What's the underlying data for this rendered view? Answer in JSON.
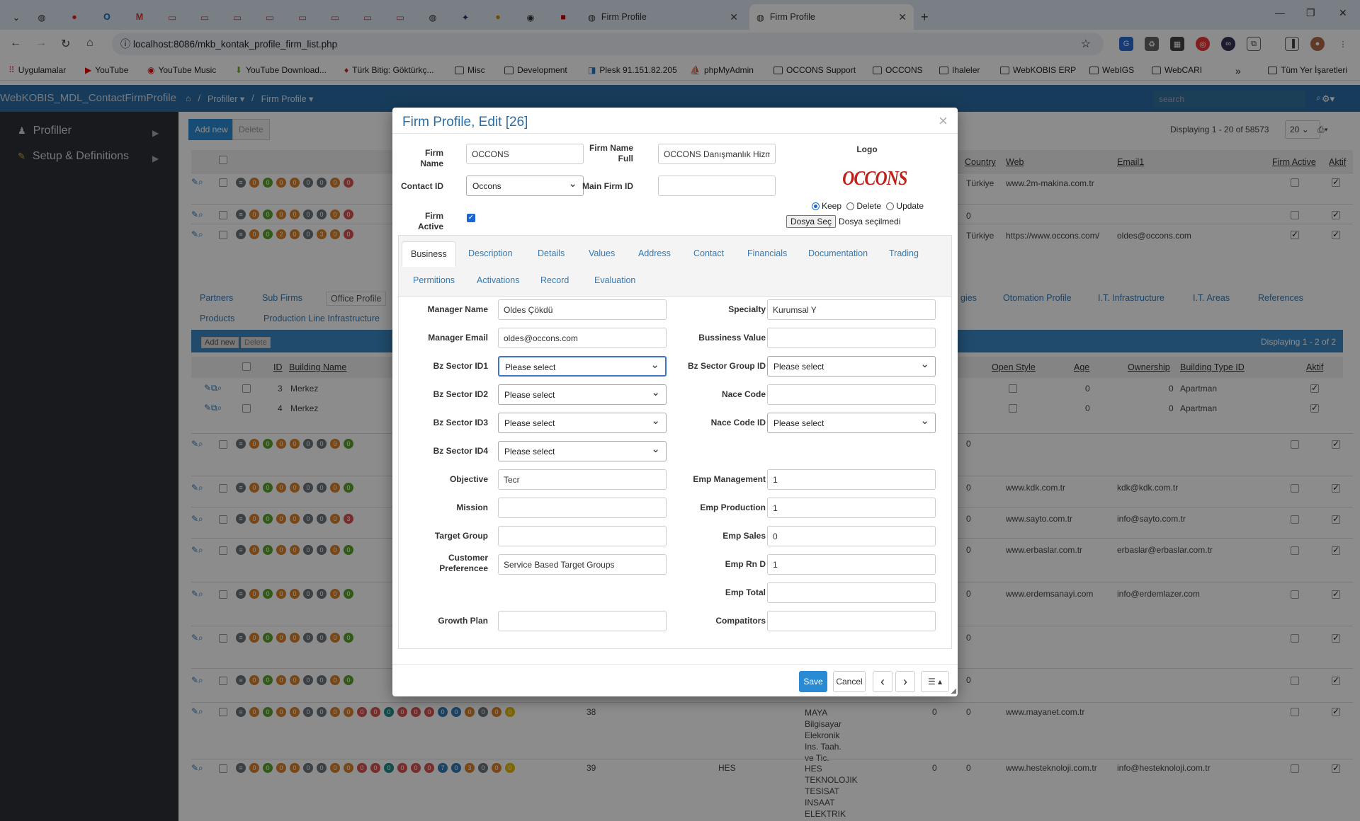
{
  "browser": {
    "tabs": [
      {
        "label": "Firm Profile",
        "active": false
      },
      {
        "label": "Firm Profile",
        "active": true
      }
    ],
    "url": "localhost:8086/mkb_kontak_profile_firm_list.php",
    "new_tab": "+",
    "bookmarks": [
      "Uygulamalar",
      "YouTube",
      "YouTube Music",
      "YouTube Download...",
      "Türk Bitig: Göktürkç...",
      "Misc",
      "Development",
      "Plesk 91.151.82.205",
      "phpMyAdmin",
      "OCCONS Support",
      "OCCONS",
      "Ihaleler",
      "WebKOBIS ERP",
      "WebIGS",
      "WebCARI",
      "Tüm Yer İşaretleri"
    ]
  },
  "app": {
    "title": "WebKOBIS_MDL_ContactFirmProfile",
    "breadcrumb": [
      "Profiller ▾",
      "/",
      "Firm Profile ▾"
    ],
    "search_placeholder": "search",
    "sidebar": [
      {
        "label": "Profiller",
        "icon": "user-icon"
      },
      {
        "label": "Setup & Definitions",
        "icon": "wrench-icon"
      }
    ]
  },
  "background": {
    "add_new": "Add new",
    "delete": "Delete",
    "displaying": "Displaying 1 - 20 of 58573",
    "page_size": "20",
    "columns": [
      "Country",
      "Web",
      "Email1",
      "Firm Active",
      "Aktif"
    ],
    "rows": [
      {
        "country": "Türkiye",
        "web": "www.2m-makina.com.tr",
        "email": ""
      },
      {
        "country": "0",
        "web": "",
        "email": ""
      },
      {
        "country": "Türkiye",
        "web": "https://www.occons.com/",
        "email": "oldes@occons.com"
      }
    ],
    "detail_links": [
      "Partners",
      "Sub Firms",
      "Office Profile",
      "Products",
      "Production Line Infrastructure",
      "gies",
      "Otomation Profile",
      "I.T. Infrastructure",
      "I.T. Areas",
      "References"
    ],
    "sub_add_new": "Add new",
    "sub_delete": "Delete",
    "sub_displaying": "Displaying 1 - 2 of 2",
    "sub_columns": [
      "ID",
      "Building Name",
      "Open Style",
      "Age",
      "Ownership",
      "Building Type ID",
      "Aktif"
    ],
    "sub_rows": [
      {
        "id": "3",
        "name": "Merkez",
        "age": "0",
        "ownership": "0",
        "type": "Apartman"
      },
      {
        "id": "4",
        "name": "Merkez",
        "age": "0",
        "ownership": "0",
        "type": "Apartman"
      }
    ],
    "lower_rows": [
      {
        "zero": "0",
        "web": "",
        "email": ""
      },
      {
        "zero": "0",
        "web": "www.kdk.com.tr",
        "email": "kdk@kdk.com.tr"
      },
      {
        "zero": "0",
        "web": "www.sayto.com.tr",
        "email": "info@sayto.com.tr"
      },
      {
        "zero": "0",
        "web": "www.erbaslar.com.tr",
        "email": "erbaslar@erbaslar.com.tr"
      },
      {
        "zero": "0",
        "web": "www.erdemsanayi.com",
        "email": "info@erdemlazer.com"
      },
      {
        "zero": "0",
        "web": "",
        "email": ""
      },
      {
        "zero": "0",
        "web": "",
        "email": ""
      }
    ],
    "row38": {
      "id": "38",
      "name": "MAYA Bilgisayar Elekronik Ins. Taah. ve Tic.",
      "a": "0",
      "b": "0",
      "web": "www.mayanet.com.tr"
    },
    "row39": {
      "id": "39",
      "short": "HES",
      "name": "HES TEKNOLOJIK TESISAT INSAAT ELEKTRIK",
      "a": "0",
      "b": "0",
      "web": "www.hesteknoloji.com.tr",
      "email": "info@hesteknoloji.com.tr"
    }
  },
  "modal": {
    "title": "Firm Profile, Edit [26]",
    "close": "×",
    "firm_name_label": "Firm Name",
    "firm_name": "OCCONS",
    "firm_name_full_label": "Firm Name Full",
    "firm_name_full": "OCCONS Danışmanlık Hizm",
    "contact_id_label": "Contact ID",
    "contact_id": "Occons",
    "main_firm_id_label": "Main Firm ID",
    "main_firm_id": "",
    "firm_active_label": "Firm Active",
    "logo_label": "Logo",
    "logo_text": "OCCONS",
    "logo_options": [
      "Keep",
      "Delete",
      "Update"
    ],
    "file_button": "Dosya Seç",
    "file_status": "Dosya seçilmedi",
    "tabs": [
      "Business",
      "Description",
      "Details",
      "Values",
      "Address",
      "Contact",
      "Financials",
      "Documentation",
      "Trading",
      "Permitions",
      "Activations",
      "Record",
      "Evaluation"
    ],
    "fields": {
      "manager_name": {
        "label": "Manager Name",
        "value": "Oldes Çökdü"
      },
      "manager_email": {
        "label": "Manager Email",
        "value": "oldes@occons.com"
      },
      "bz_sector_id1": {
        "label": "Bz Sector ID1",
        "value": "Please select"
      },
      "bz_sector_id2": {
        "label": "Bz Sector ID2",
        "value": "Please select"
      },
      "bz_sector_id3": {
        "label": "Bz Sector ID3",
        "value": "Please select"
      },
      "bz_sector_id4": {
        "label": "Bz Sector ID4",
        "value": "Please select"
      },
      "objective": {
        "label": "Objective",
        "value": "Tecr"
      },
      "mission": {
        "label": "Mission",
        "value": ""
      },
      "target_group": {
        "label": "Target Group",
        "value": ""
      },
      "customer_preference": {
        "label1": "Customer",
        "label2": "Preferencee",
        "value": "Service Based Target Groups"
      },
      "growth_plan": {
        "label": "Growth Plan",
        "value": ""
      },
      "specialty": {
        "label": "Specialty",
        "value": "Kurumsal Y"
      },
      "bussiness_value": {
        "label": "Bussiness Value",
        "value": ""
      },
      "bz_sector_group_id": {
        "label": "Bz Sector Group ID",
        "value": "Please select"
      },
      "nace_code": {
        "label": "Nace Code",
        "value": ""
      },
      "nace_code_id": {
        "label": "Nace Code ID",
        "value": "Please select"
      },
      "emp_management": {
        "label": "Emp Management",
        "value": "1"
      },
      "emp_production": {
        "label": "Emp Production",
        "value": "1"
      },
      "emp_sales": {
        "label": "Emp Sales",
        "value": "0"
      },
      "emp_rn_d": {
        "label": "Emp Rn D",
        "value": "1"
      },
      "emp_total": {
        "label": "Emp Total",
        "value": ""
      },
      "compatitors": {
        "label": "Compatitors",
        "value": ""
      }
    },
    "save": "Save",
    "cancel": "Cancel",
    "prev": "‹",
    "next": "›",
    "menu": "☰ ▴"
  }
}
